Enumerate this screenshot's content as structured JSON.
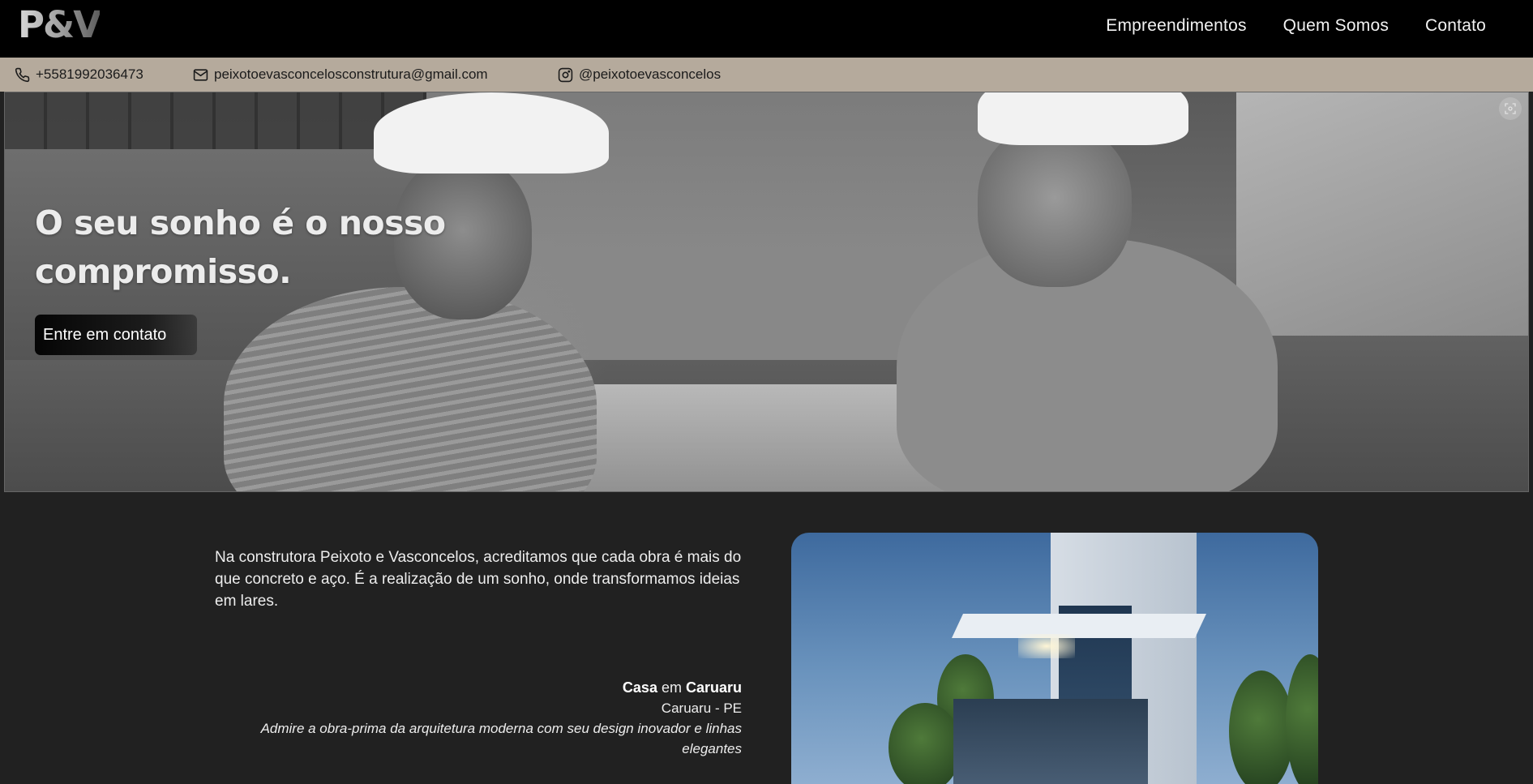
{
  "header": {
    "logo_text": "P&V",
    "nav": [
      "Empreendimentos",
      "Quem Somos",
      "Contato"
    ]
  },
  "contact": {
    "phone": "+5581992036473",
    "email": "peixotoevasconcelosconstrutura@gmail.com",
    "instagram": "@peixotoevasconcelos"
  },
  "hero": {
    "title": "O seu sonho é o nosso compromisso.",
    "cta_label": "Entre em contato"
  },
  "intro": {
    "text": "Na construtora Peixoto e Vasconcelos, acreditamos que cada obra é mais do que concreto e aço. É a realização de um sonho, onde transformamos ideias em lares."
  },
  "project": {
    "title_part1": "Casa",
    "title_mid": " em ",
    "title_part2": "Caruaru",
    "location": "Caruaru - PE",
    "description": "Admire a obra-prima da arquitetura moderna com seu design inovador e linhas elegantes"
  },
  "colors": {
    "header_bg": "#000000",
    "contact_bar_bg": "#b5aa9c",
    "page_bg": "#212121"
  }
}
